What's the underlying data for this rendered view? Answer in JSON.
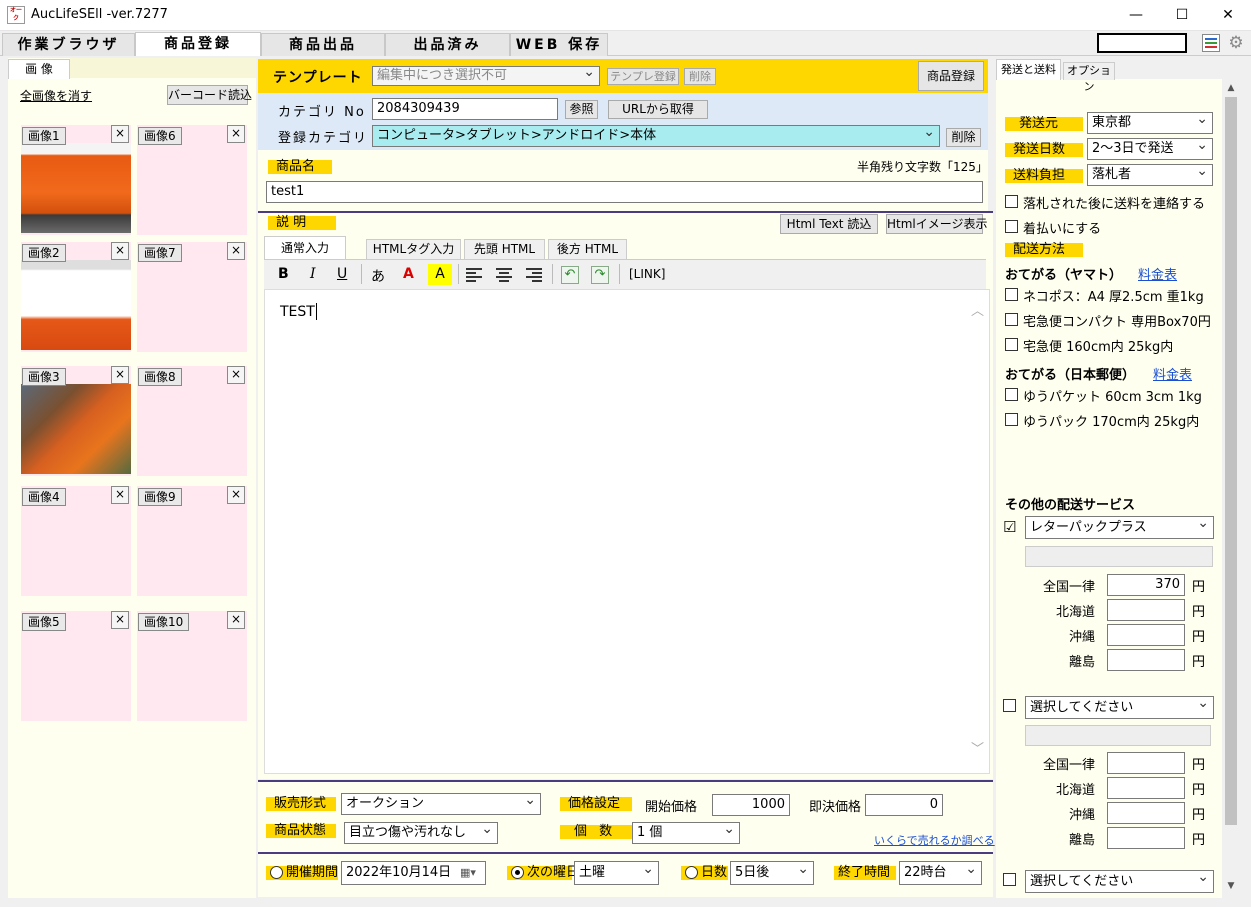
{
  "window": {
    "title": "AucLifeSEll -ver.7277",
    "minimize": "—",
    "maximize": "☐",
    "close": "✕",
    "icon_text": "オーク"
  },
  "main_tabs": [
    "作業ブラウザ",
    "商品登録",
    "商品出品",
    "出品済み",
    "WEB 保存"
  ],
  "left": {
    "tab": "画 像",
    "clear_all": "全画像を消す",
    "barcode_btn": "バーコード読込",
    "close_glyph": "×",
    "images": [
      {
        "label": "画像1"
      },
      {
        "label": "画像6"
      },
      {
        "label": "画像2"
      },
      {
        "label": "画像7"
      },
      {
        "label": "画像3"
      },
      {
        "label": "画像8"
      },
      {
        "label": "画像4"
      },
      {
        "label": "画像9"
      },
      {
        "label": "画像5"
      },
      {
        "label": "画像10"
      }
    ]
  },
  "template": {
    "label": "テンプレート",
    "value": "編集中につき選択不可",
    "register_btn": "テンプレ登録",
    "delete_btn": "削除",
    "item_register_btn": "商品登録"
  },
  "category": {
    "no_label": "カテゴリ No",
    "no_value": "2084309439",
    "ref_btn": "参照",
    "url_btn": "URLから取得",
    "reg_label": "登録カテゴリ",
    "reg_value": "コンピュータ>タブレット>アンドロイド>本体",
    "delete_btn": "削除"
  },
  "item_name": {
    "label": "商品名",
    "remaining": "半角残り文字数「125」",
    "value": "test1"
  },
  "description": {
    "label": "説 明",
    "html_text_btn": "Html Text 読込",
    "html_image_btn": "Htmlイメージ表示",
    "tabs": [
      "通常入力",
      "HTMLタグ入力",
      "先頭 HTML",
      "後方 HTML"
    ],
    "toolbar": {
      "bold": "B",
      "italic": "I",
      "underline": "U",
      "kana": "あ",
      "color_a": "A",
      "highlight_a": "A",
      "link": "[LINK]"
    },
    "body": "TEST"
  },
  "sale": {
    "format_label": "販売形式",
    "format_value": "オークション",
    "price_label": "価格設定",
    "start_label": "開始価格",
    "start_value": "1000",
    "buyout_label": "即決価格",
    "buyout_value": "0",
    "condition_label": "商品状態",
    "condition_value": "目立つ傷や汚れなし",
    "qty_label": "個 数",
    "qty_value": "1 個",
    "research_link": "いくらで売れるか調べる"
  },
  "period": {
    "period_label": "開催期間",
    "date_value": "2022年10月14日",
    "weekday_label": "次の曜日",
    "weekday_value": "土曜",
    "days_label": "日数",
    "days_value": "5日後",
    "end_label": "終了時間",
    "end_value": "22時台"
  },
  "right": {
    "tabs": [
      "発送と送料",
      "オプション"
    ],
    "origin_label": "発送元",
    "origin_value": "東京都",
    "days_label": "発送日数",
    "days_value": "2〜3日で発送",
    "burden_label": "送料負担",
    "burden_value": "落札者",
    "notify_text": "落札された後に送料を連絡する",
    "cod_text": "着払いにする",
    "method_label": "配送方法",
    "yamato_head": "おてがる（ヤマト）",
    "fee_table": "料金表",
    "yamato_opts": [
      "ネコポス：A4 厚2.5cm 重1kg",
      "宅急便コンパクト 専用Box70円",
      "宅急便 160cm内 25kg内"
    ],
    "jp_head": "おてがる（日本郵便）",
    "jp_opts": [
      "ゆうパケット 60cm 3cm 1kg",
      "ゆうパック 170cm内 25kg内"
    ],
    "other_head": "その他の配送サービス",
    "service1": "レターパックプラス",
    "regions": [
      "全国一律",
      "北海道",
      "沖縄",
      "離島"
    ],
    "uniform_price": "370",
    "yen": "円",
    "service2": "選択してください",
    "service3": "選択してください"
  },
  "colors": {
    "yellow": "#ffd700",
    "pink": "#ffe8f0",
    "cream": "#fffff0",
    "blue_bg": "#dde9f7",
    "cyan_sel": "#a8ecf0"
  }
}
